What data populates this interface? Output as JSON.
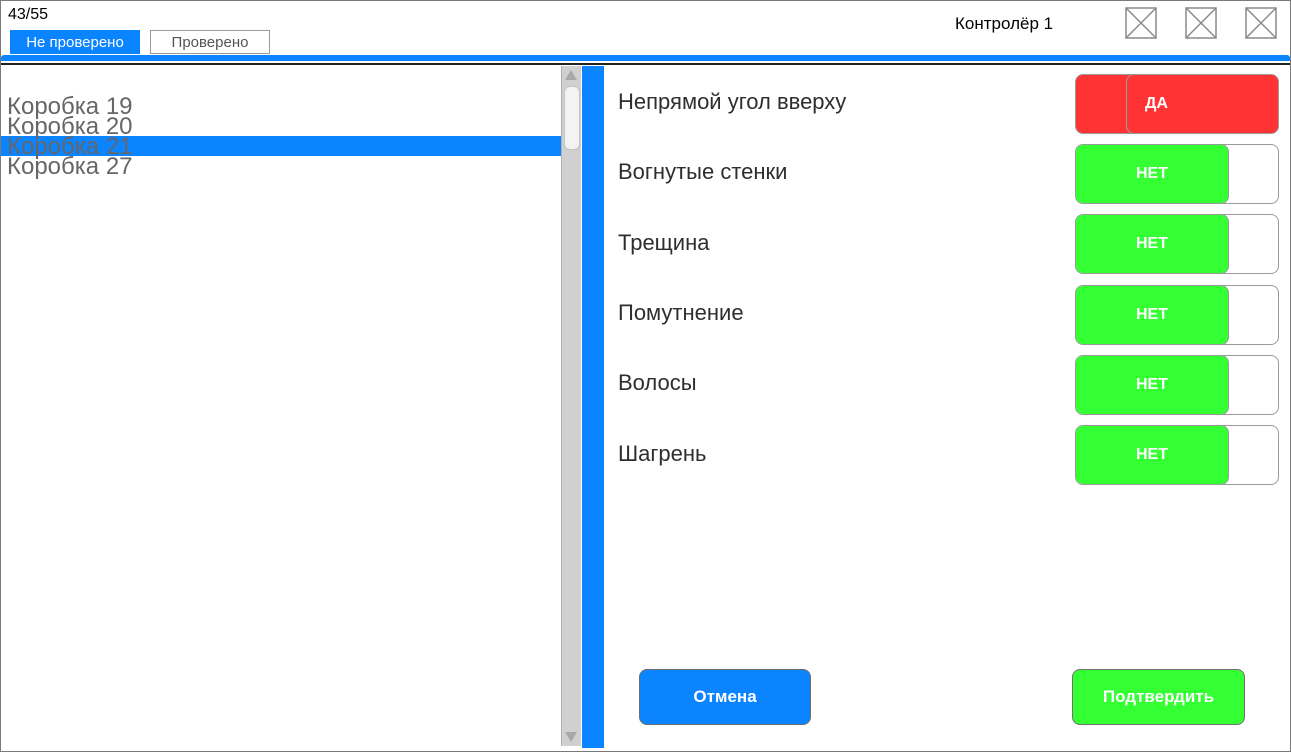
{
  "header": {
    "counter": "43/55",
    "controller": "Контролёр 1",
    "tabs": [
      {
        "label": "Не проверено",
        "active": true
      },
      {
        "label": "Проверено",
        "active": false
      }
    ],
    "window_icons": [
      "placeholder-icon",
      "placeholder-icon",
      "placeholder-icon"
    ]
  },
  "box_list": {
    "items": [
      {
        "label": "Коробка 19",
        "selected": false
      },
      {
        "label": "Коробка 20",
        "selected": false
      },
      {
        "label": "Коробка 21",
        "selected": true
      },
      {
        "label": "Коробка 27",
        "selected": false
      }
    ]
  },
  "defects": [
    {
      "label": "Непрямой угол вверху",
      "value": "ДА"
    },
    {
      "label": "Вогнутые стенки",
      "value": "НЕТ"
    },
    {
      "label": "Трещина",
      "value": "НЕТ"
    },
    {
      "label": "Помутнение",
      "value": "НЕТ"
    },
    {
      "label": "Волосы",
      "value": "НЕТ"
    },
    {
      "label": "Шагрень",
      "value": "НЕТ"
    }
  ],
  "actions": {
    "cancel_label": "Отмена",
    "confirm_label": "Подтвердить"
  },
  "colors": {
    "accent": "#0a84ff",
    "yes": "#ff3333",
    "no": "#33ff33"
  }
}
